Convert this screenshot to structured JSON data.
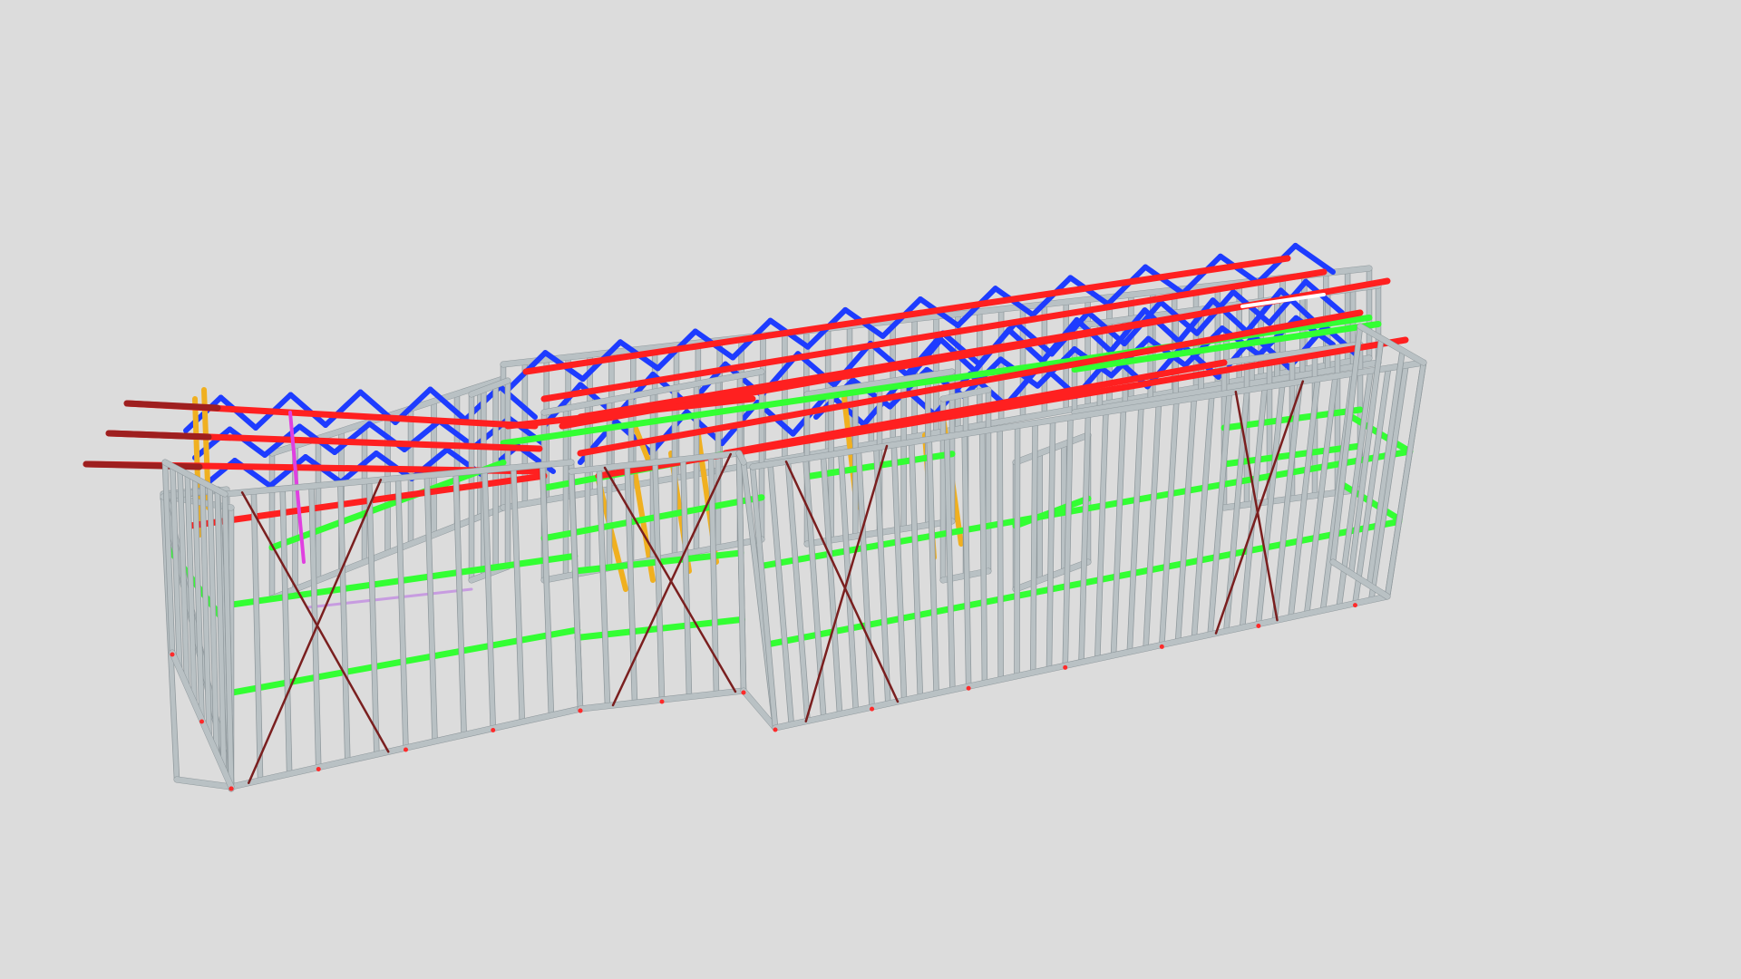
{
  "scene": {
    "background": "#dcdcdc",
    "colors": {
      "stud": "#b9c1c4",
      "stud_edge": "#8f989c",
      "noggin": "#33ff33",
      "brace": "#7a1f1f",
      "truss_chord": "#ff2020",
      "truss_web": "#1e3cff",
      "overhang": "#9e1f1f",
      "lintel": "#f0b020",
      "service": "#e040e0",
      "anchor": "#ff2a2a"
    }
  }
}
